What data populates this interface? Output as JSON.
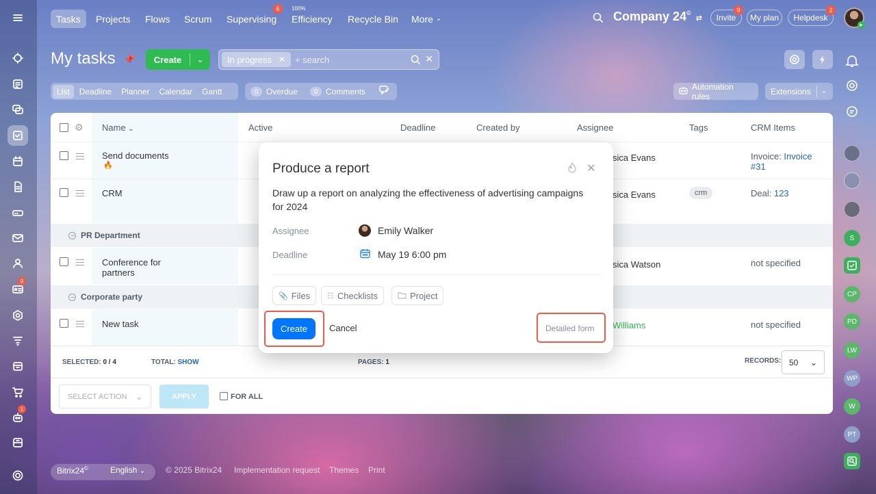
{
  "nav": {
    "tabs": [
      "Tasks",
      "Projects",
      "Flows",
      "Scrum",
      "Supervising",
      "Efficiency",
      "Recycle Bin",
      "More"
    ],
    "supervising_badge": "6",
    "efficiency_pct": "100%",
    "company": "Company 24",
    "invite": "Invite",
    "invite_badge": "9",
    "myplan": "My plan",
    "helpdesk": "Helpdesk",
    "helpdesk_badge": "2"
  },
  "left_badges": {
    "feed": "9",
    "robot": "1"
  },
  "header": {
    "title": "My tasks",
    "create": "Create",
    "filter_chip": "In progress",
    "search_placeholder": "+ search"
  },
  "views": [
    "List",
    "Deadline",
    "Planner",
    "Calendar",
    "Gantt"
  ],
  "counters": {
    "overdue_count": "0",
    "overdue": "Overdue",
    "comments_count": "0",
    "comments": "Comments"
  },
  "tools": {
    "automation": "Automation rules",
    "extensions": "Extensions"
  },
  "columns": {
    "name": "Name",
    "active": "Active",
    "deadline": "Deadline",
    "created_by": "Created by",
    "assignee": "Assignee",
    "tags": "Tags",
    "crm": "CRM Items"
  },
  "rows": [
    {
      "name": "Send documents",
      "assignee": "sica Evans",
      "crm_label": "Invoice: ",
      "crm_link_a": "Invoice",
      "crm_link_b": "#31"
    },
    {
      "name": "CRM",
      "assignee": "sica Evans",
      "tag": "crm",
      "crm_label": "Deal: ",
      "crm_link": "123"
    },
    {
      "name_a": "Conference for",
      "name_b": "partners",
      "assignee": "sica Watson",
      "crm": "not specified"
    },
    {
      "name": "New task",
      "assignee": "Williams",
      "crm": "not specified"
    }
  ],
  "groups": [
    "PR Department",
    "Corporate party"
  ],
  "grid_footer": {
    "selected_label": "SELECTED:",
    "selected": "0 / 4",
    "total_label": "TOTAL:",
    "total_link": "SHOW",
    "pages_label": "PAGES:",
    "pages": "1",
    "records_label": "RECORDS:",
    "records": "50",
    "select_action": "SELECT ACTION",
    "apply": "APPLY",
    "for_all": "FOR ALL"
  },
  "popup": {
    "title": "Produce a report",
    "description": "Draw up a report on analyzing the effectiveness of advertising campaigns for 2024",
    "assignee_label": "Assignee",
    "assignee": "Emily Walker",
    "deadline_label": "Deadline",
    "deadline": "May 19 6:00 pm",
    "files": "Files",
    "checklists": "Checklists",
    "project": "Project",
    "create": "Create",
    "cancel": "Cancel",
    "detailed": "Detailed form"
  },
  "right_avatars": [
    "S",
    "CP",
    "PD",
    "LW",
    "WP",
    "W",
    "PT"
  ],
  "footer": {
    "brand": "Bitrix24",
    "lang": "English",
    "copyright": "© 2025 Bitrix24",
    "impl": "Implementation request",
    "themes": "Themes",
    "print": "Print"
  },
  "colors": {
    "accent_blue": "#0075ff",
    "create_green": "#2fba52",
    "highlight_red": "#ee5a4a",
    "link_blue": "#2067b0"
  }
}
